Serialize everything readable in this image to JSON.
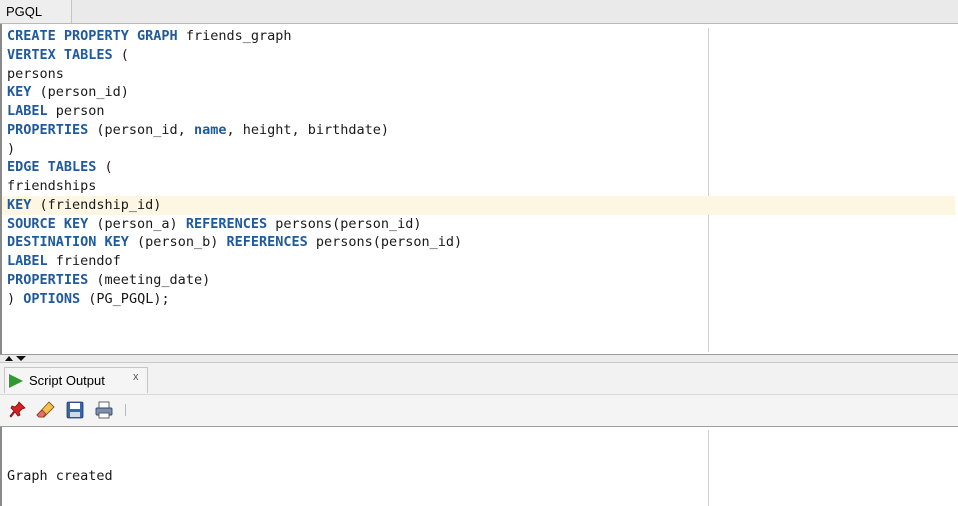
{
  "tab": {
    "label": "PGQL"
  },
  "editor": {
    "lines": [
      [
        {
          "t": "CREATE PROPERTY GRAPH",
          "k": 1
        },
        {
          "t": " friends_graph",
          "k": 0
        }
      ],
      [
        {
          "t": "VERTEX TABLES",
          "k": 1
        },
        {
          "t": " (",
          "k": 0
        }
      ],
      [
        {
          "t": "persons",
          "k": 0
        }
      ],
      [
        {
          "t": "KEY",
          "k": 1
        },
        {
          "t": " (person_id)",
          "k": 0
        }
      ],
      [
        {
          "t": "LABEL",
          "k": 1
        },
        {
          "t": " person",
          "k": 0
        }
      ],
      [
        {
          "t": "PROPERTIES",
          "k": 1
        },
        {
          "t": " (person_id, ",
          "k": 0
        },
        {
          "t": "name",
          "k": 1
        },
        {
          "t": ", height, birthdate)",
          "k": 0
        }
      ],
      [
        {
          "t": ")",
          "k": 0
        }
      ],
      [
        {
          "t": "EDGE TABLES",
          "k": 1
        },
        {
          "t": " (",
          "k": 0
        }
      ],
      [
        {
          "t": "friendships",
          "k": 0
        }
      ],
      [
        {
          "t": "KEY",
          "k": 1
        },
        {
          "t": " (friendship_id)",
          "k": 0
        }
      ],
      [
        {
          "t": "SOURCE KEY",
          "k": 1
        },
        {
          "t": " (person_a) ",
          "k": 0
        },
        {
          "t": "REFERENCES",
          "k": 1
        },
        {
          "t": " persons(person_id)",
          "k": 0
        }
      ],
      [
        {
          "t": "DESTINATION KEY",
          "k": 1
        },
        {
          "t": " (person_b) ",
          "k": 0
        },
        {
          "t": "REFERENCES",
          "k": 1
        },
        {
          "t": " persons(person_id)",
          "k": 0
        }
      ],
      [
        {
          "t": "LABEL",
          "k": 1
        },
        {
          "t": " friendof",
          "k": 0
        }
      ],
      [
        {
          "t": "PROPERTIES",
          "k": 1
        },
        {
          "t": " (meeting_date)",
          "k": 0
        }
      ],
      [
        {
          "t": ") ",
          "k": 0
        },
        {
          "t": "OPTIONS",
          "k": 1
        },
        {
          "t": " (PG_PGQL);",
          "k": 0
        }
      ]
    ],
    "highlighted_line": 9
  },
  "output_panel": {
    "tab_label": "Script Output",
    "close_label": "x",
    "toolbar": [
      "pin-icon",
      "eraser-icon",
      "save-icon",
      "print-icon"
    ],
    "text": "Graph created"
  },
  "colors": {
    "keyword": "#1f5a9d",
    "current_line": "#fdf6e3",
    "run_icon": "#2f9a2f"
  }
}
